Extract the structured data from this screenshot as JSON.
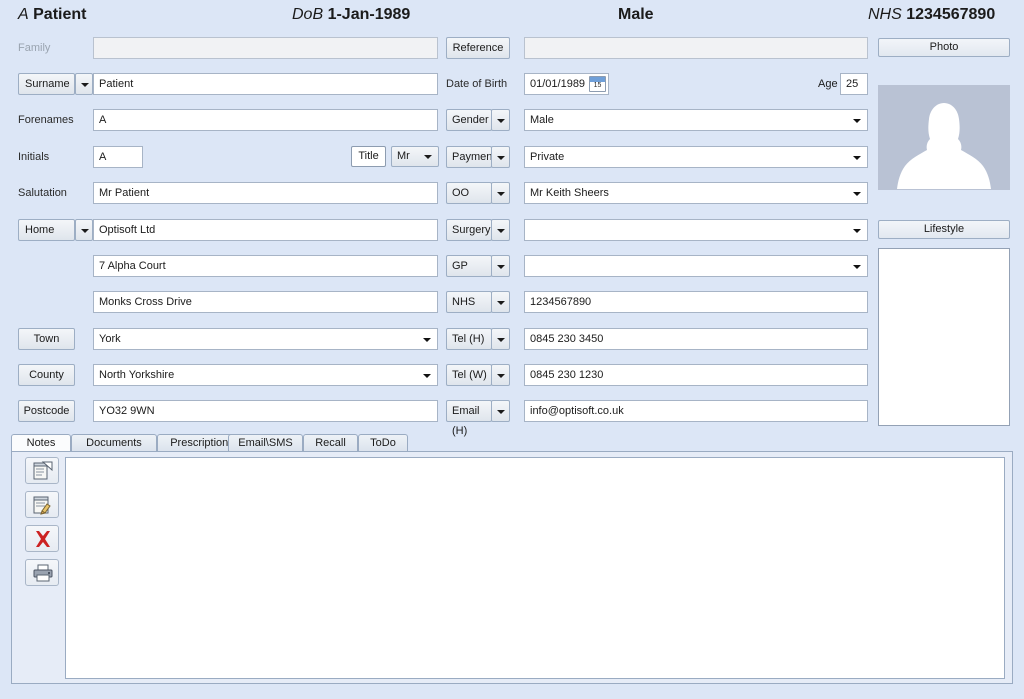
{
  "header": {
    "patient_initial": "A",
    "patient_surname": "Patient",
    "dob_label": "DoB",
    "dob_value": "1-Jan-1989",
    "gender": "Male",
    "nhs_label": "NHS",
    "nhs_value": "1234567890"
  },
  "left": {
    "family_label": "Family",
    "family_value": "",
    "surname_label": "Surname",
    "surname_value": "Patient",
    "forenames_label": "Forenames",
    "forenames_value": "A",
    "initials_label": "Initials",
    "initials_value": "A",
    "title_label": "Title",
    "title_value": "Mr",
    "salutation_label": "Salutation",
    "salutation_value": "Mr Patient",
    "home_label": "Home",
    "address1_value": "Optisoft Ltd",
    "address2_value": "7 Alpha Court",
    "address3_value": "Monks Cross Drive",
    "town_label": "Town",
    "town_value": "York",
    "county_label": "County",
    "county_value": "North Yorkshire",
    "postcode_label": "Postcode",
    "postcode_value": "YO32 9WN"
  },
  "middle": {
    "reference_label": "Reference",
    "reference_value": "",
    "dob_label": "Date of Birth",
    "dob_value": "01/01/1989",
    "calendar_day": "15",
    "age_label": "Age",
    "age_value": "25",
    "gender_label": "Gender",
    "gender_value": "Male",
    "payment_label": "Payment",
    "payment_value": "Private",
    "oo_label": "OO",
    "oo_value": "Mr Keith Sheers",
    "surgery_label": "Surgery",
    "surgery_value": "",
    "gp_label": "GP",
    "gp_value": "",
    "nhs_label": "NHS",
    "nhs_value": "1234567890",
    "tel_home_label": "Tel (H)",
    "tel_home_value": "0845 230 3450",
    "tel_work_label": "Tel (W)",
    "tel_work_value": "0845 230 1230",
    "email_home_label": "Email (H)",
    "email_home_value": "info@optisoft.co.uk"
  },
  "right": {
    "photo_label": "Photo",
    "lifestyle_label": "Lifestyle"
  },
  "tabs": [
    {
      "label": "Notes",
      "active": true
    },
    {
      "label": "Documents",
      "active": false
    },
    {
      "label": "Prescriptions",
      "active": false
    },
    {
      "label": "Email\\SMS",
      "active": false
    },
    {
      "label": "Recall",
      "active": false
    },
    {
      "label": "ToDo",
      "active": false
    }
  ],
  "notes": {
    "content": "",
    "toolbar": [
      {
        "icon": "new-note-icon"
      },
      {
        "icon": "edit-note-icon"
      },
      {
        "icon": "delete-icon"
      },
      {
        "icon": "print-icon"
      }
    ]
  },
  "colors": {
    "background": "#dce6f6",
    "field_border": "#a7b4c6",
    "delete_red": "#cc2222",
    "photo_bg": "#b9c2d4"
  }
}
